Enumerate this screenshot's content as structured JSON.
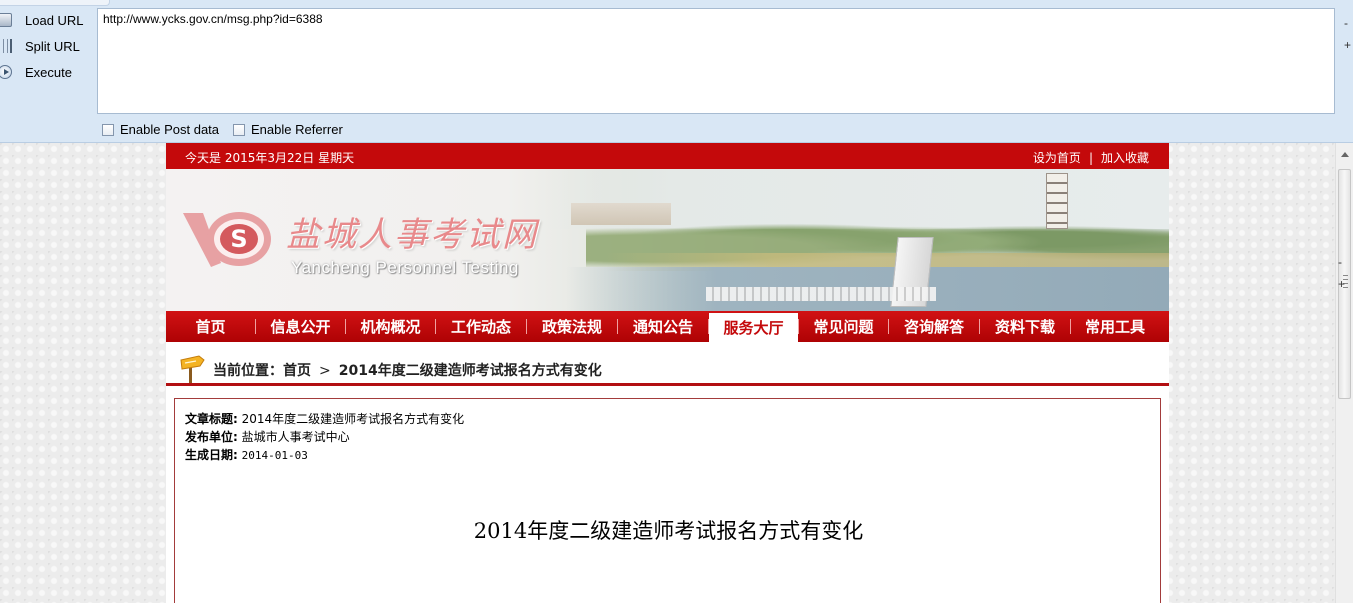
{
  "toolbar": {
    "load_url_label": "Load URL",
    "split_url_label": "Split URL",
    "execute_label": "Execute",
    "url_value": "http://www.ycks.gov.cn/msg.php?id=6388",
    "enable_post_label": "Enable Post data",
    "enable_referrer_label": "Enable Referrer",
    "right_marks": [
      "-",
      "+",
      "-",
      "+"
    ]
  },
  "site": {
    "today_text": "今天是 2015年3月22日 星期天",
    "set_home_label": "设为首页",
    "link_sep": "|",
    "add_fav_label": "加入收藏",
    "title": "盐城人事考试网",
    "subtitle": "Yancheng Personnel Testing",
    "nav": [
      {
        "label": "首页",
        "active": false
      },
      {
        "label": "信息公开",
        "active": false
      },
      {
        "label": "机构概况",
        "active": false
      },
      {
        "label": "工作动态",
        "active": false
      },
      {
        "label": "政策法规",
        "active": false
      },
      {
        "label": "通知公告",
        "active": false
      },
      {
        "label": "服务大厅",
        "active": true
      },
      {
        "label": "常见问题",
        "active": false
      },
      {
        "label": "咨询解答",
        "active": false
      },
      {
        "label": "资料下载",
        "active": false
      },
      {
        "label": "常用工具",
        "active": false
      }
    ],
    "accent_color": "#c4090b"
  },
  "breadcrumb": {
    "prefix": "当前位置：首页",
    "separator": ">",
    "current": "2014年度二级建造师考试报名方式有变化"
  },
  "article": {
    "title_label": "文章标题:",
    "title_value": "2014年度二级建造师考试报名方式有变化",
    "publisher_label": "发布单位:",
    "publisher_value": "盐城市人事考试中心",
    "date_label": "生成日期:",
    "date_value": "2014-01-03",
    "heading": "2014年度二级建造师考试报名方式有变化"
  }
}
